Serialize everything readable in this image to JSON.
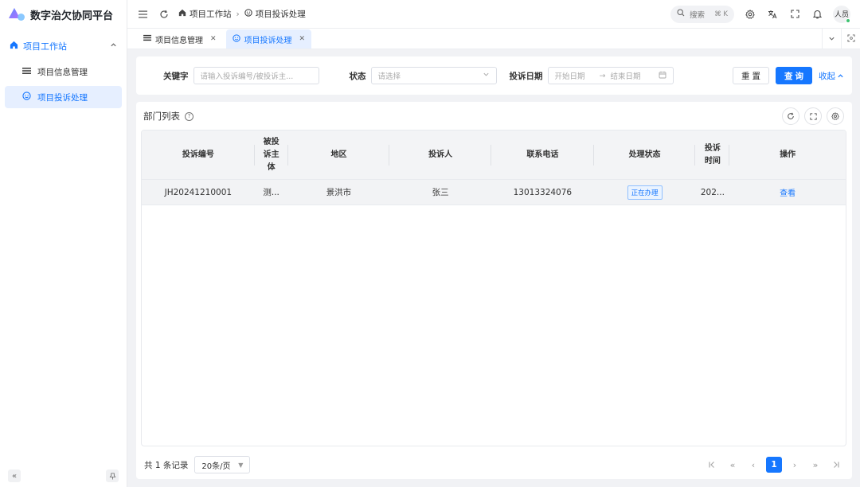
{
  "app": {
    "title": "数字治欠协同平台"
  },
  "sidebar": {
    "group_label": "项目工作站",
    "items": [
      {
        "label": "项目信息管理"
      },
      {
        "label": "项目投诉处理"
      }
    ]
  },
  "header": {
    "breadcrumb": [
      "项目工作站",
      "项目投诉处理"
    ],
    "search_label": "搜索",
    "search_shortcut": "⌘ K",
    "avatar_text": "人员"
  },
  "tabs": [
    {
      "label": "项目信息管理"
    },
    {
      "label": "项目投诉处理"
    }
  ],
  "filter": {
    "keyword_label": "关键字",
    "keyword_placeholder": "请输入投诉编号/被投诉主...",
    "status_label": "状态",
    "status_placeholder": "请选择",
    "date_label": "投诉日期",
    "date_start_placeholder": "开始日期",
    "date_arrow": "→",
    "date_end_placeholder": "结束日期",
    "reset_label": "重 置",
    "query_label": "查 询",
    "collapse_label": "收起"
  },
  "table": {
    "title": "部门列表",
    "columns": [
      "投诉编号",
      "被投诉主体",
      "地区",
      "投诉人",
      "联系电话",
      "处理状态",
      "投诉时间",
      "操作"
    ],
    "rows": [
      {
        "code": "JH20241210001",
        "subject": "测...",
        "region": "景洪市",
        "complainant": "张三",
        "phone": "13013324076",
        "status": "正在办理",
        "time": "202...",
        "action": "查看"
      }
    ]
  },
  "pagination": {
    "total_text": "共 1 条记录",
    "page_size": "20条/页",
    "current_page": "1"
  },
  "colors": {
    "primary": "#1677ff",
    "active_bg": "#e6efff",
    "page_bg": "#f1f2f5"
  }
}
